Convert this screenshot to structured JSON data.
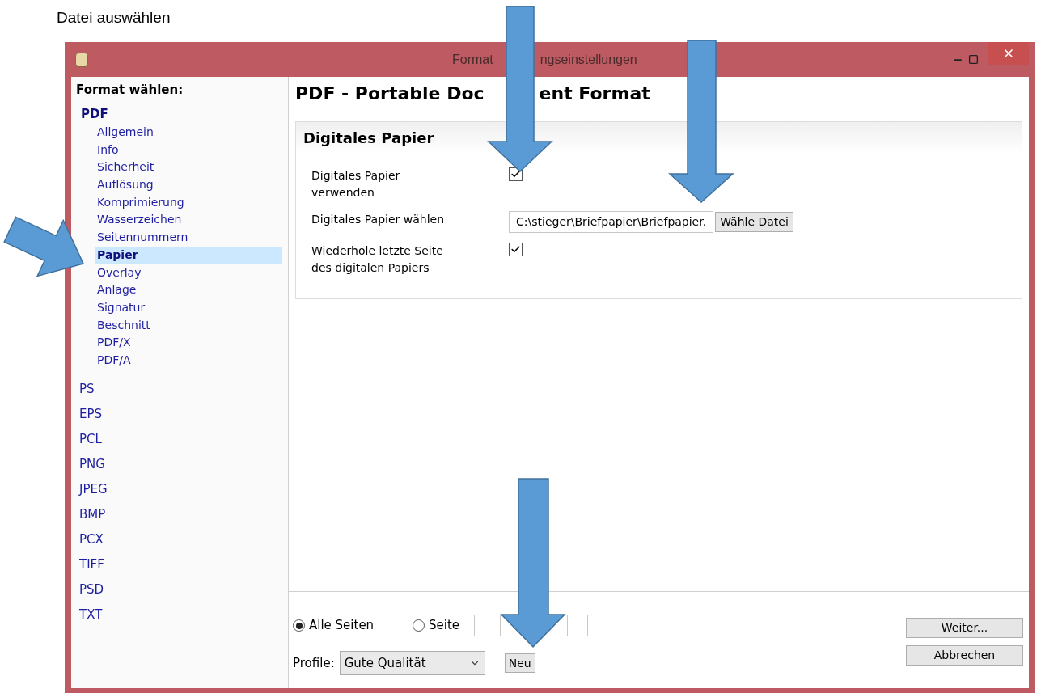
{
  "caption": "Datei auswählen",
  "window": {
    "title_parts": [
      "Format",
      "ngseinstellungen"
    ]
  },
  "sidebar": {
    "heading": "Format wählen:",
    "items": [
      {
        "label": "PDF",
        "expanded": true,
        "selected": false,
        "children": [
          {
            "label": "Allgemein",
            "selected": false
          },
          {
            "label": "Info",
            "selected": false
          },
          {
            "label": "Sicherheit",
            "selected": false
          },
          {
            "label": "Auflösung",
            "selected": false
          },
          {
            "label": "Komprimierung",
            "selected": false
          },
          {
            "label": "Wasserzeichen",
            "selected": false
          },
          {
            "label": "Seitennummern",
            "selected": false
          },
          {
            "label": "Papier",
            "selected": true
          },
          {
            "label": "Overlay",
            "selected": false
          },
          {
            "label": "Anlage",
            "selected": false
          },
          {
            "label": "Signatur",
            "selected": false
          },
          {
            "label": "Beschnitt",
            "selected": false
          },
          {
            "label": "PDF/X",
            "selected": false
          },
          {
            "label": "PDF/A",
            "selected": false
          }
        ]
      },
      {
        "label": "PS",
        "expanded": false,
        "selected": false
      },
      {
        "label": "EPS",
        "expanded": false,
        "selected": false
      },
      {
        "label": "PCL",
        "expanded": false,
        "selected": false
      },
      {
        "label": "PNG",
        "expanded": false,
        "selected": false
      },
      {
        "label": "JPEG",
        "expanded": false,
        "selected": false
      },
      {
        "label": "BMP",
        "expanded": false,
        "selected": false
      },
      {
        "label": "PCX",
        "expanded": false,
        "selected": false
      },
      {
        "label": "TIFF",
        "expanded": false,
        "selected": false
      },
      {
        "label": "PSD",
        "expanded": false,
        "selected": false
      },
      {
        "label": "TXT",
        "expanded": false,
        "selected": false
      }
    ]
  },
  "main": {
    "heading_parts": [
      "PDF - Portable Doc",
      "ent Format"
    ],
    "group": {
      "title": "Digitales Papier",
      "rows": [
        {
          "kind": "checkbox",
          "label": "Digitales Papier verwenden",
          "checked": true
        },
        {
          "kind": "file",
          "label": "Digitales Papier wählen",
          "value": "C:\\stieger\\Briefpapier\\Briefpapier.",
          "button": "Wähle Datei"
        },
        {
          "kind": "checkbox",
          "label": "Wiederhole letzte Seite des digitalen Papiers",
          "checked": true
        }
      ]
    }
  },
  "footer": {
    "radios": [
      {
        "label": "Alle Seiten",
        "selected": true
      },
      {
        "label": "Seite",
        "selected": false
      }
    ],
    "profile_label": "Profile:",
    "profile_value": "Gute Qualität",
    "new_button": "Neu",
    "buttons": [
      "Weiter...",
      "Abbrechen"
    ]
  }
}
